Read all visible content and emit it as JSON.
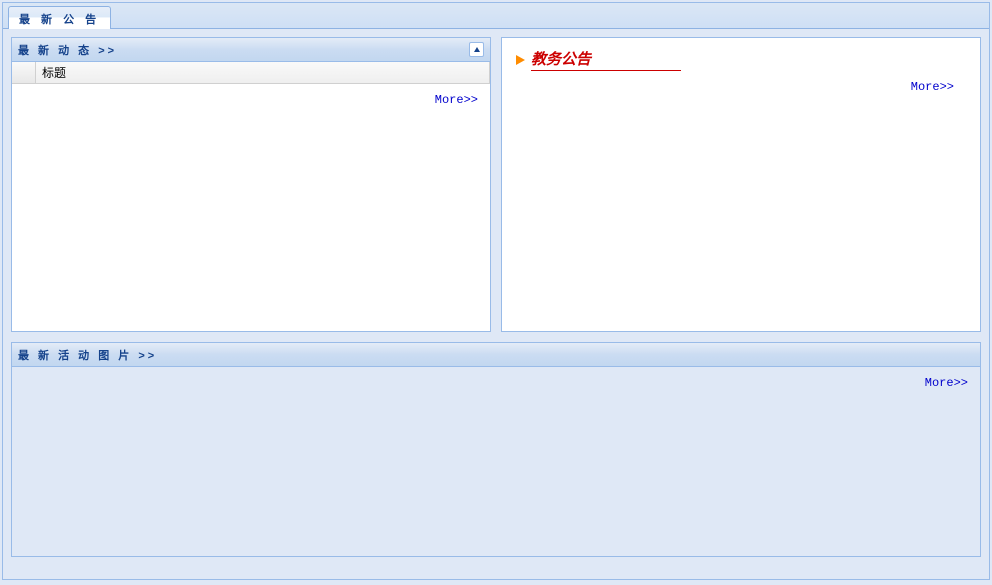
{
  "tab": {
    "label": "最 新 公 告"
  },
  "panels": {
    "latest_news": {
      "title": "最 新 动 态 >>",
      "column_title": "标题",
      "more_label": "More>>"
    },
    "academic_notice": {
      "title": "教务公告",
      "more_label": "More>>"
    },
    "latest_photos": {
      "title": "最 新 活 动 图 片 >>",
      "more_label": "More>>"
    }
  }
}
